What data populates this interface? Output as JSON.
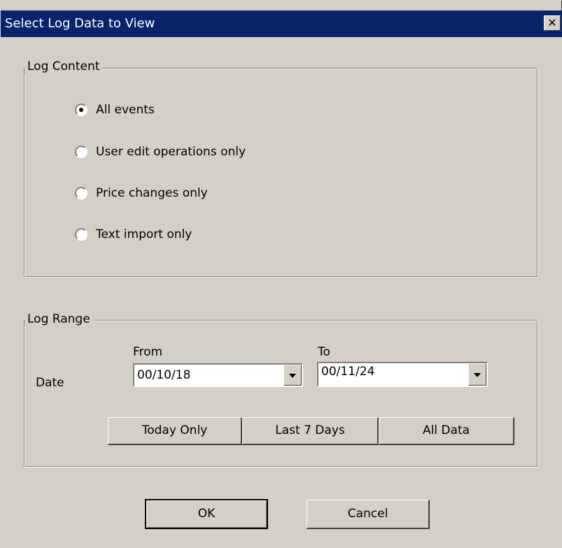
{
  "window": {
    "title": "Select Log Data to View",
    "close_glyph": "✕"
  },
  "log_content": {
    "group_label": "Log Content",
    "options": [
      {
        "label": "All events",
        "selected": true
      },
      {
        "label": "User edit operations only",
        "selected": false
      },
      {
        "label": "Price changes only",
        "selected": false
      },
      {
        "label": "Text import only",
        "selected": false
      }
    ]
  },
  "log_range": {
    "group_label": "Log Range",
    "from_label": "From",
    "to_label": "To",
    "date_label": "Date",
    "from_value": "00/10/18",
    "to_value": "00/11/24",
    "buttons": {
      "today_only": "Today Only",
      "last_7_days": "Last 7 Days",
      "all_data": "All Data"
    }
  },
  "actions": {
    "ok": "OK",
    "cancel": "Cancel"
  },
  "colors": {
    "titlebar": "#0a246a",
    "dialog_face": "#d4d0c8"
  },
  "icons": {
    "close": "close-icon",
    "dropdown": "chevron-down-icon"
  }
}
